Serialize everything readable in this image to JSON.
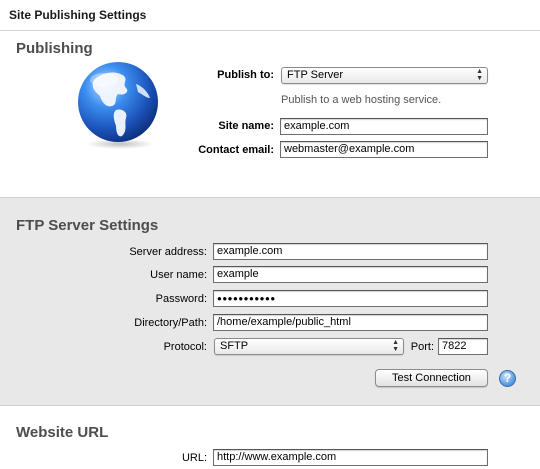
{
  "window": {
    "title": "Site Publishing Settings"
  },
  "publishing": {
    "header": "Publishing",
    "publish_to_label": "Publish to:",
    "publish_to_value": "FTP Server",
    "publish_to_hint": "Publish to a web hosting service.",
    "site_name_label": "Site name:",
    "site_name_value": "example.com",
    "contact_email_label": "Contact email:",
    "contact_email_value": "webmaster@example.com",
    "icon": "globe-icon"
  },
  "ftp": {
    "header": "FTP Server Settings",
    "server_address_label": "Server address:",
    "server_address_value": "example.com",
    "user_name_label": "User name:",
    "user_name_value": "example",
    "password_label": "Password:",
    "password_value": "●●●●●●●●●●●",
    "directory_label": "Directory/Path:",
    "directory_value": "/home/example/public_html",
    "protocol_label": "Protocol:",
    "protocol_value": "SFTP",
    "port_label": "Port:",
    "port_value": "7822",
    "test_connection_label": "Test Connection",
    "help_glyph": "?"
  },
  "website_url": {
    "header": "Website URL",
    "url_label": "URL:",
    "url_value": "http://www.example.com"
  },
  "colors": {
    "pane_background": "#e8e8e8",
    "header_text": "#4d4d4d",
    "globe_blue": "#2f6fd1"
  }
}
